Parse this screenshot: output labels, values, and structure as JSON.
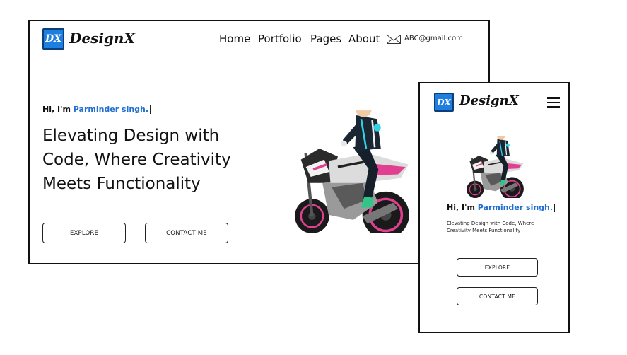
{
  "brand": {
    "badge": "DX",
    "name": "DesignX"
  },
  "nav": {
    "items": [
      "Home",
      "Portfolio",
      "Pages",
      "About"
    ],
    "email": "ABC@gmail.com"
  },
  "hero": {
    "greeting": "Hi, I'm ",
    "name": "Parminder singh.",
    "headline_lines": [
      "Elevating Design with",
      "Code, Where Creativity",
      "Meets Functionality"
    ],
    "buttons": {
      "explore": "EXPLORE",
      "contact": "CONTACT ME"
    }
  },
  "mobile": {
    "greeting": "Hi, I'm ",
    "name": "Parminder singh.",
    "description": "Elevating Design with Code, Where Creativity Meets Functionality",
    "buttons": {
      "explore": "EXPLORE",
      "contact": "CONTACT ME"
    }
  },
  "colors": {
    "accent": "#1f6fd1",
    "badge": "#1f7fe0",
    "border": "#111111"
  },
  "icons": [
    "mail-icon",
    "hamburger-menu-icon"
  ]
}
